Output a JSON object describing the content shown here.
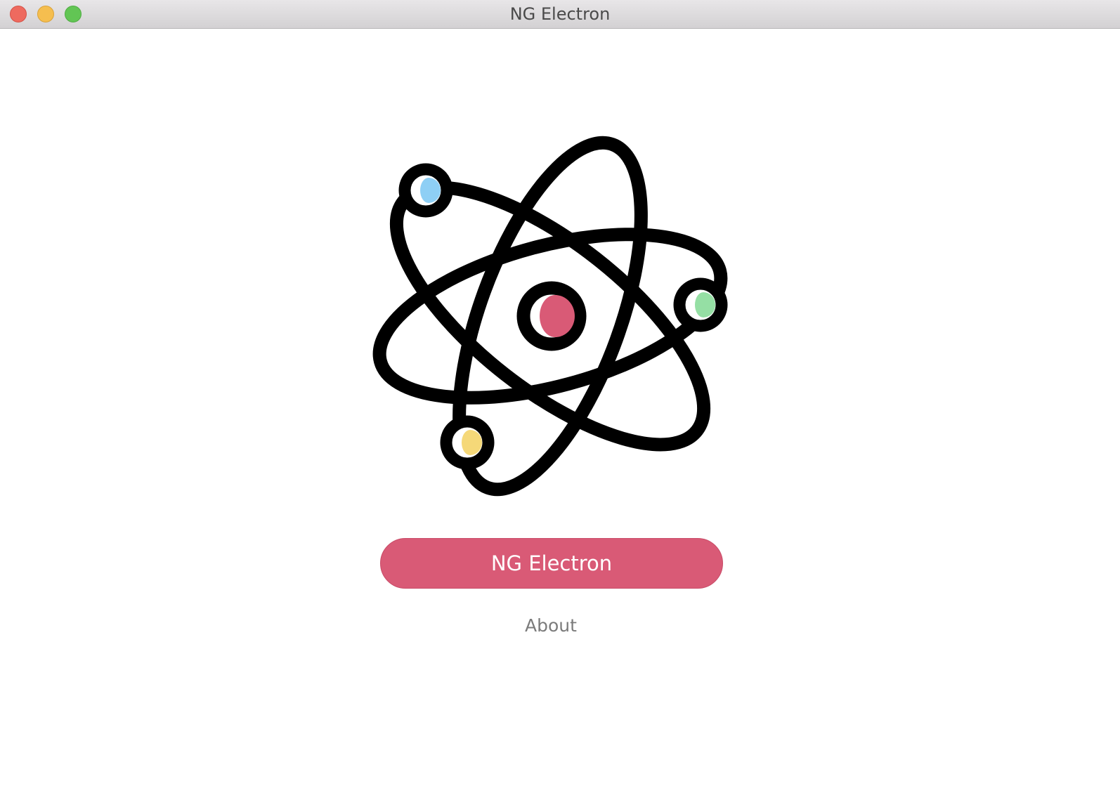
{
  "window": {
    "title": "NG Electron"
  },
  "main": {
    "primary_button_label": "NG Electron",
    "about_link_label": "About"
  },
  "logo": {
    "icon": "atom-icon",
    "nucleus_color": "#d95a76",
    "electron_colors": [
      "#8ecff5",
      "#95dfa4",
      "#f5d878"
    ]
  }
}
